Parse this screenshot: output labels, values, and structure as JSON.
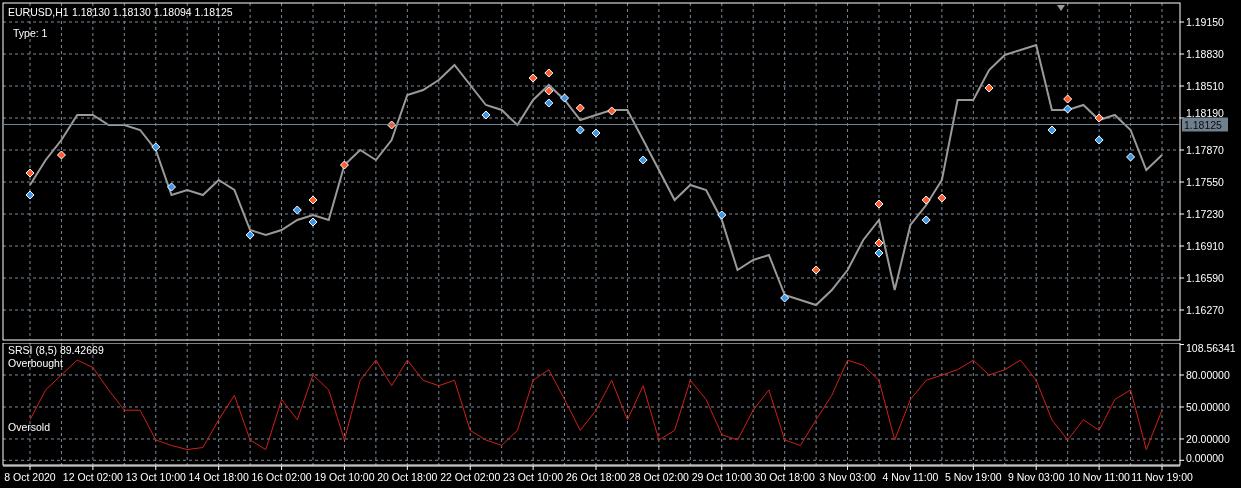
{
  "chart": {
    "symbol": "EURUSD,H1",
    "ohlc": "1.18130 1.18130 1.18094 1.18125",
    "type_label": "Type: 1",
    "chart_data": {
      "type": "line",
      "grid": true,
      "ylim": [
        1.1597,
        1.1934
      ],
      "yticks": [
        {
          "value": 1.1915,
          "label": "1.19150"
        },
        {
          "value": 1.1883,
          "label": "1.18830"
        },
        {
          "value": 1.1851,
          "label": "1.18510"
        },
        {
          "value": 1.1819,
          "label": "1.18190"
        },
        {
          "value": 1.1787,
          "label": "1.17870"
        },
        {
          "value": 1.1755,
          "label": "1.17550"
        },
        {
          "value": 1.1723,
          "label": "1.17230"
        },
        {
          "value": 1.1691,
          "label": "1.16910"
        },
        {
          "value": 1.1659,
          "label": "1.16590"
        },
        {
          "value": 1.1627,
          "label": "1.16270"
        }
      ],
      "series": [
        {
          "color": "#9a9a9a",
          "values": [
            1.1752,
            1.1777,
            1.1797,
            1.1822,
            1.1822,
            1.1812,
            1.1812,
            1.1807,
            1.1787,
            1.1742,
            1.1747,
            1.1742,
            1.1757,
            1.1747,
            1.1707,
            1.1702,
            1.1707,
            1.1717,
            1.1722,
            1.1717,
            1.1772,
            1.1787,
            1.1777,
            1.1797,
            1.1842,
            1.1847,
            1.1857,
            1.1872,
            1.1852,
            1.1832,
            1.1827,
            1.1812,
            1.1837,
            1.1852,
            1.1837,
            1.1817,
            1.1822,
            1.1827,
            1.1827,
            1.1797,
            1.1767,
            1.1737,
            1.1752,
            1.1747,
            1.1717,
            1.1667,
            1.1677,
            1.1682,
            1.1642,
            1.1637,
            1.1632,
            1.1647,
            1.1667,
            1.1697,
            1.1717,
            1.1647,
            1.1712,
            1.1732,
            1.1757,
            1.1837,
            1.1837,
            1.1867,
            1.1882,
            1.1887,
            1.1892,
            1.1827,
            1.1827,
            1.1832,
            1.1817,
            1.1822,
            1.1807,
            1.1767,
            1.1782
          ]
        },
        {
          "type": "scatter",
          "color": "#ff5a2a",
          "values": [
            1.1764,
            null,
            1.1782,
            null,
            null,
            null,
            null,
            null,
            null,
            null,
            null,
            null,
            null,
            null,
            null,
            null,
            null,
            null,
            1.1737,
            null,
            1.1772,
            null,
            null,
            1.1812,
            null,
            null,
            null,
            null,
            null,
            null,
            null,
            null,
            1.1859,
            1.1864,
            null,
            1.1829,
            null,
            1.1826,
            null,
            null,
            null,
            null,
            null,
            null,
            null,
            null,
            null,
            null,
            null,
            null,
            1.1667,
            null,
            null,
            null,
            1.1733,
            null,
            null,
            1.1737,
            1.1739,
            null,
            null,
            1.1849,
            null,
            null,
            null,
            null,
            1.1838,
            null,
            1.1819,
            null,
            null,
            null,
            null
          ]
        },
        {
          "type": "scatter",
          "color": "#ff5a2a",
          "values": [
            null,
            null,
            null,
            null,
            null,
            null,
            null,
            null,
            null,
            null,
            null,
            null,
            null,
            null,
            null,
            null,
            null,
            null,
            null,
            null,
            null,
            null,
            null,
            null,
            null,
            null,
            null,
            null,
            null,
            null,
            null,
            null,
            null,
            1.1846,
            null,
            null,
            null,
            null,
            null,
            null,
            null,
            null,
            null,
            null,
            null,
            null,
            null,
            null,
            null,
            null,
            null,
            null,
            null,
            null,
            1.1694,
            null,
            null,
            null,
            null,
            null,
            null,
            null,
            null,
            null,
            null,
            null,
            null,
            null,
            null,
            null,
            null,
            null,
            null
          ]
        },
        {
          "type": "scatter",
          "color": "#3a96ea",
          "values": [
            1.1742,
            null,
            null,
            null,
            null,
            null,
            null,
            null,
            1.179,
            1.175,
            null,
            null,
            null,
            null,
            1.1702,
            null,
            null,
            1.1727,
            1.1715,
            null,
            null,
            null,
            null,
            null,
            null,
            null,
            null,
            null,
            null,
            1.1822,
            null,
            null,
            null,
            1.1834,
            1.1839,
            1.1807,
            1.1804,
            null,
            null,
            1.1777,
            null,
            null,
            null,
            null,
            1.1722,
            null,
            null,
            null,
            1.1639,
            null,
            null,
            null,
            null,
            null,
            1.1684,
            null,
            null,
            1.1717,
            null,
            null,
            null,
            null,
            null,
            null,
            null,
            1.1807,
            1.1828,
            null,
            1.1797,
            null,
            1.178,
            null,
            null
          ]
        }
      ],
      "ref_lines": [
        {
          "axis": "y",
          "value": 1.18125,
          "label": "1.18125"
        }
      ]
    }
  },
  "indicator": {
    "header": "SRSI (8,5) 89.42669",
    "level_labels": [
      "Overbought",
      "Oversold"
    ],
    "chart_data": {
      "type": "line",
      "grid": true,
      "ylim": [
        -4.4,
        110
      ],
      "categories": [
        "8 Oct 2020",
        null,
        null,
        null,
        "12 Oct 02:00",
        null,
        null,
        null,
        "13 Oct 10:00",
        null,
        null,
        null,
        "14 Oct 18:00",
        null,
        null,
        null,
        "16 Oct 02:00",
        null,
        null,
        null,
        "19 Oct 10:00",
        null,
        null,
        null,
        "20 Oct 18:00",
        null,
        null,
        null,
        "22 Oct 02:00",
        null,
        null,
        null,
        "23 Oct 10:00",
        null,
        null,
        null,
        "26 Oct 18:00",
        null,
        null,
        null,
        "28 Oct 02:00",
        null,
        null,
        null,
        "29 Oct 10:00",
        null,
        null,
        null,
        "30 Oct 18:00",
        null,
        null,
        null,
        "3 Nov 03:00",
        null,
        null,
        null,
        "4 Nov 11:00",
        null,
        null,
        null,
        "5 Nov 19:00",
        null,
        null,
        null,
        "9 Nov 03:00",
        null,
        null,
        null,
        "10 Nov 11:00",
        null,
        null,
        null,
        "11 Nov 19:00"
      ],
      "yticks": [
        {
          "value": 108.56341,
          "label": "108.56341"
        },
        {
          "value": 80,
          "label": "80.00000"
        },
        {
          "value": 50,
          "label": "50.00000"
        },
        {
          "value": 20,
          "label": "20.00000"
        },
        {
          "value": 0,
          "label": "0.00000"
        }
      ],
      "series": [
        {
          "color": "#d0201a",
          "values": [
            38,
            66,
            80,
            94,
            87,
            66,
            47,
            47,
            19,
            14,
            10,
            12,
            38,
            61,
            19,
            10,
            57,
            38,
            80,
            66,
            19,
            75,
            94,
            70,
            94,
            75,
            70,
            75,
            28,
            19,
            14,
            28,
            75,
            85,
            57,
            28,
            47,
            75,
            38,
            70,
            19,
            28,
            75,
            57,
            24,
            19,
            47,
            66,
            19,
            14,
            38,
            61,
            94,
            89,
            75,
            19,
            57,
            75,
            80,
            85,
            94,
            80,
            85,
            94,
            75,
            38,
            19,
            38,
            28,
            57,
            66,
            10,
            47
          ]
        }
      ]
    }
  }
}
